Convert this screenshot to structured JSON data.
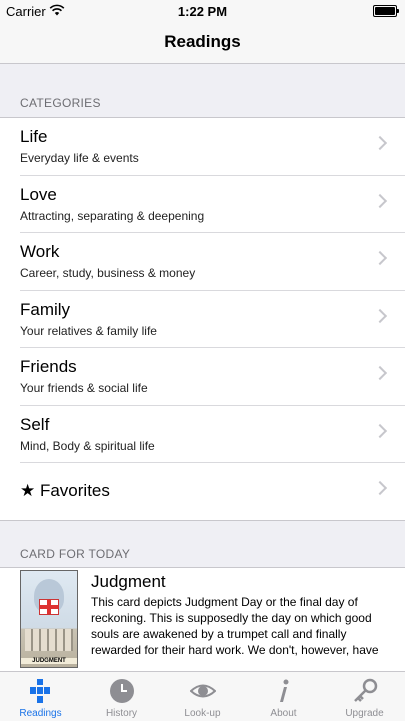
{
  "status": {
    "carrier": "Carrier",
    "time": "1:22 PM"
  },
  "nav": {
    "title": "Readings"
  },
  "categories": {
    "header": "CATEGORIES",
    "items": [
      {
        "title": "Life",
        "subtitle": "Everyday life & events"
      },
      {
        "title": "Love",
        "subtitle": "Attracting, separating & deepening"
      },
      {
        "title": "Work",
        "subtitle": "Career, study, business & money"
      },
      {
        "title": "Family",
        "subtitle": "Your relatives & family life"
      },
      {
        "title": "Friends",
        "subtitle": "Your friends & social life"
      },
      {
        "title": "Self",
        "subtitle": "Mind, Body & spiritual life"
      },
      {
        "title": "★ Favorites",
        "subtitle": ""
      }
    ]
  },
  "today": {
    "header": "CARD FOR TODAY",
    "card_label": "JUDGMENT",
    "title": "Judgment",
    "text": "This card depicts Judgment Day or the final day of reckoning. This is supposedly the day on which good souls are awakened by a trumpet call and finally rewarded for their hard work. We don't, however, have to wait till then to experience such a life-chan…"
  },
  "tabs": [
    {
      "label": "Readings",
      "icon": "readings-icon",
      "active": true
    },
    {
      "label": "History",
      "icon": "clock-icon"
    },
    {
      "label": "Look-up",
      "icon": "eye-icon"
    },
    {
      "label": "About",
      "icon": "info-icon"
    },
    {
      "label": "Upgrade",
      "icon": "key-icon"
    }
  ],
  "colors": {
    "accent": "#1a73e8",
    "inactive": "#8e8e93"
  }
}
